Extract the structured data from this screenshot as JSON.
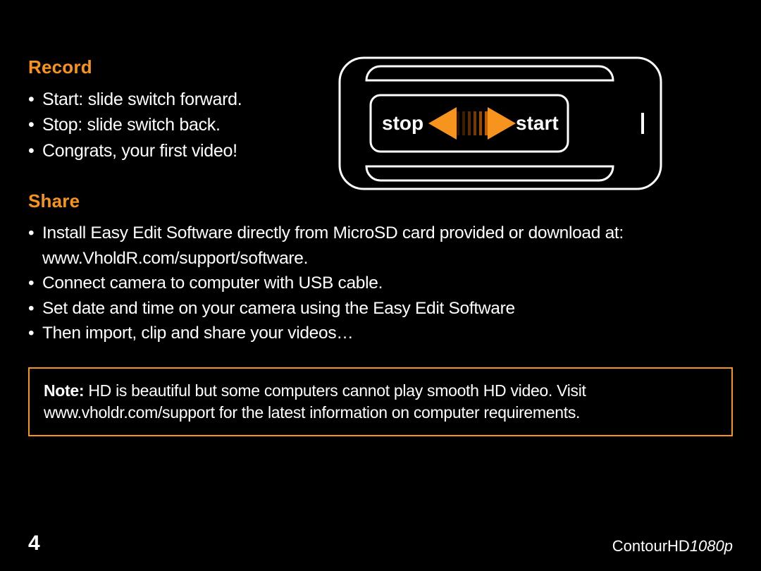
{
  "sections": {
    "record": {
      "heading": "Record",
      "items": [
        "Start: slide switch forward.",
        "Stop: slide switch back.",
        "Congrats, your first video!"
      ]
    },
    "share": {
      "heading": "Share",
      "items": [
        "Install Easy Edit Software directly from MicroSD card provided or download at: www.VholdR.com/support/software.",
        "Connect camera to computer with USB cable.",
        "Set date and time on your camera using the Easy Edit Software",
        "Then import, clip and share your videos…"
      ]
    }
  },
  "diagram": {
    "stop_label": "stop",
    "start_label": "start"
  },
  "note": {
    "label": "Note:",
    "text": " HD is beautiful but some computers cannot play smooth HD video. Visit www.vholdr.com/support for the latest information on computer requirements."
  },
  "footer": {
    "page_number": "4",
    "model_prefix": "ContourHD",
    "model_suffix": "1080p"
  },
  "colors": {
    "accent": "#f7941d",
    "bg": "#000000",
    "fg": "#ffffff"
  }
}
